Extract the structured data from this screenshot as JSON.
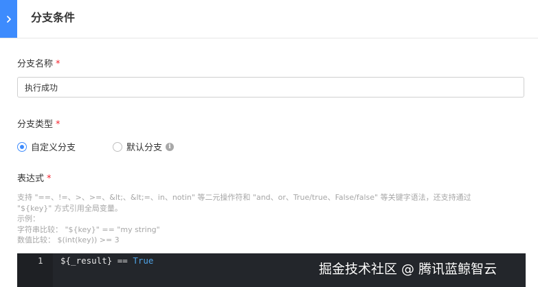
{
  "header": {
    "title": "分支条件",
    "toggle_icon": "chevron-right-icon"
  },
  "branch_name": {
    "label": "分支名称",
    "required_mark": "*",
    "value": "执行成功"
  },
  "branch_type": {
    "label": "分支类型",
    "required_mark": "*",
    "options": [
      {
        "label": "自定义分支",
        "checked": true
      },
      {
        "label": "默认分支",
        "checked": false
      }
    ],
    "info_icon": "info-icon"
  },
  "expression": {
    "label": "表达式",
    "required_mark": "*",
    "help_lines": [
      "支持 \"==、!=、>、>=、&lt;、&lt;=、in、notin\" 等二元操作符和 \"and、or、True/true、False/false\" 等关键字语法，还支持通过",
      "\"${key}\" 方式引用全局变量。",
      "示例：",
      "字符串比较： \"${key}\" == \"my string\"",
      "数值比较： $(int(key)) >= 3"
    ],
    "editor": {
      "line_number": "1",
      "code_prefix": "${_result} == ",
      "code_keyword": "True"
    }
  },
  "watermark": "掘金技术社区 @ 腾讯蓝鲸智云",
  "colors": {
    "accent": "#3d8bfd",
    "required": "#f5222d",
    "editor_bg": "#23262b",
    "keyword": "#4fa3e6"
  }
}
